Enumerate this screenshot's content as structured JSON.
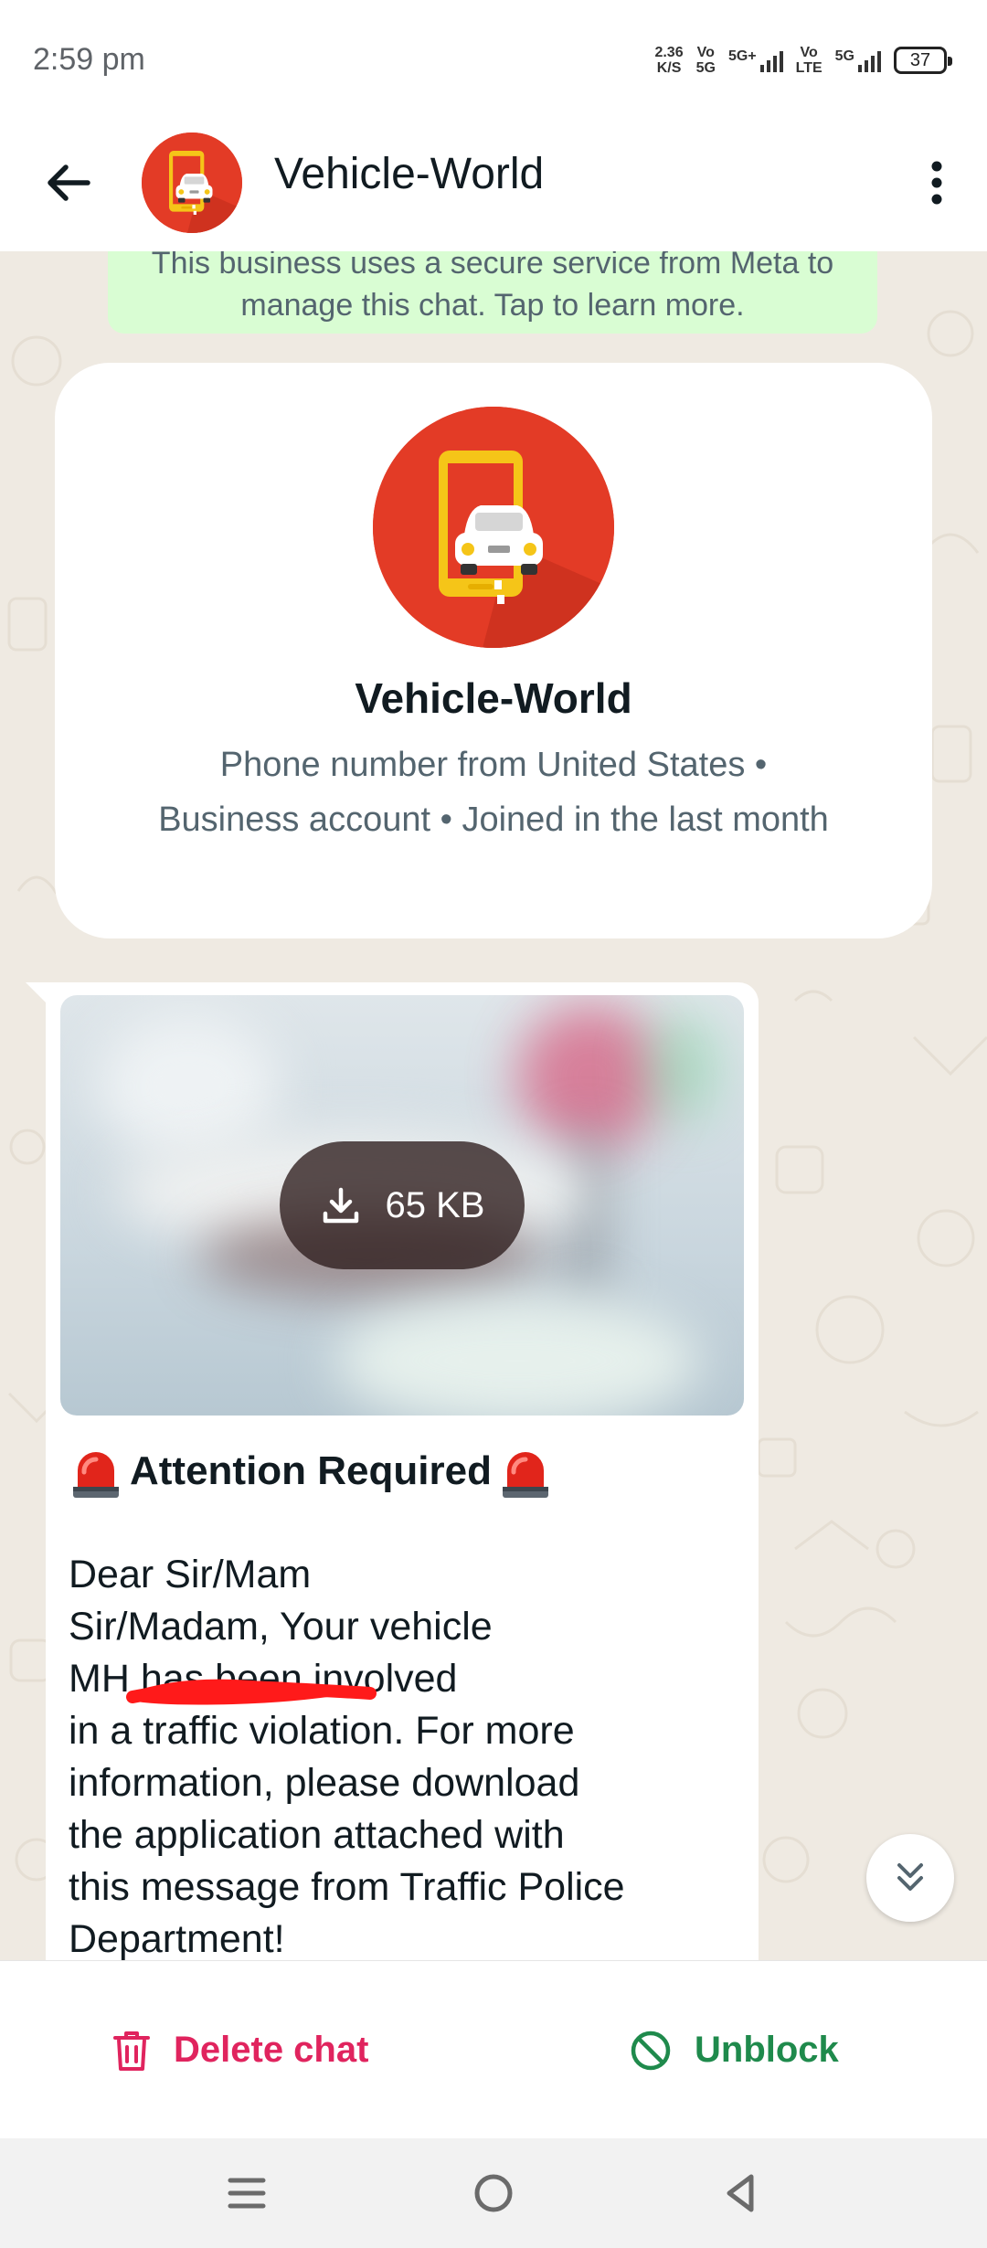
{
  "status_bar": {
    "time": "2:59 pm",
    "net_speed_value": "2.36",
    "net_speed_unit": "K/S",
    "sim1_top": "Vo",
    "sim1_bottom": "5G",
    "sim1_net": "5G+",
    "sim2_top": "Vo",
    "sim2_bottom": "LTE",
    "sim2_net": "5G",
    "battery": "37"
  },
  "header": {
    "title": "Vehicle-World"
  },
  "chat": {
    "encryption_notice": "This business uses a secure service from Meta to manage this chat. Tap to learn more.",
    "profile": {
      "name": "Vehicle-World",
      "info": "Phone number from United States • Business account • Joined in the last month"
    },
    "message": {
      "media_size": "65 KB",
      "alert_emoji": "🚨",
      "title": "Attention Required",
      "body_lines": [
        "Dear Sir/Mam",
        "Sir/Madam, Your vehicle",
        "MH          has been involved",
        "in a traffic violation. For more",
        "information, please download",
        "the application attached with",
        "this message from Traffic Police",
        "Department!"
      ]
    }
  },
  "actions": {
    "delete_label": "Delete chat",
    "unblock_label": "Unblock"
  },
  "colors": {
    "brand_red": "#e33b26",
    "delete_red": "#e0245e",
    "unblock_green": "#1f8a4c",
    "banner_green": "#d9fdd3",
    "chat_bg": "#efeae2"
  }
}
